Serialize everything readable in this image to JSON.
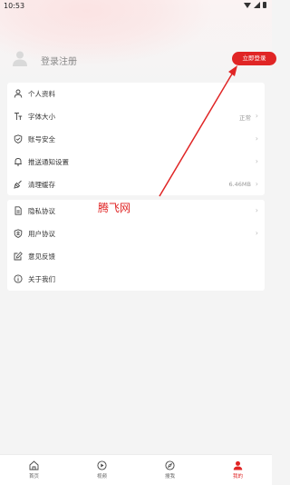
{
  "status_bar": {
    "time": "10:53"
  },
  "user": {
    "login_prompt": "登录注册",
    "login_button": "立即登录"
  },
  "menu_group_1": [
    {
      "label": "个人资料",
      "icon": "person-icon",
      "value": ""
    },
    {
      "label": "字体大小",
      "icon": "font-size-icon",
      "value": "正常"
    },
    {
      "label": "账号安全",
      "icon": "shield-check-icon",
      "value": ""
    },
    {
      "label": "推送通知设置",
      "icon": "bell-icon",
      "value": ""
    },
    {
      "label": "清理缓存",
      "icon": "broom-icon",
      "value": "6.46MB"
    }
  ],
  "menu_group_2": [
    {
      "label": "隐私协议",
      "icon": "document-icon",
      "value": ""
    },
    {
      "label": "用户协议",
      "icon": "shield-user-icon",
      "value": ""
    },
    {
      "label": "意见反馈",
      "icon": "edit-icon",
      "value": ""
    },
    {
      "label": "关于我们",
      "icon": "info-icon",
      "value": ""
    }
  ],
  "watermark": "腾飞网",
  "bottom_tabs": [
    {
      "label": "首页",
      "icon": "home-icon",
      "active": false
    },
    {
      "label": "视频",
      "icon": "play-icon",
      "active": false
    },
    {
      "label": "搜我",
      "icon": "compass-icon",
      "active": false
    },
    {
      "label": "我的",
      "icon": "user-icon",
      "active": true
    }
  ],
  "colors": {
    "accent": "#e02525",
    "background": "#f4f4f4"
  }
}
